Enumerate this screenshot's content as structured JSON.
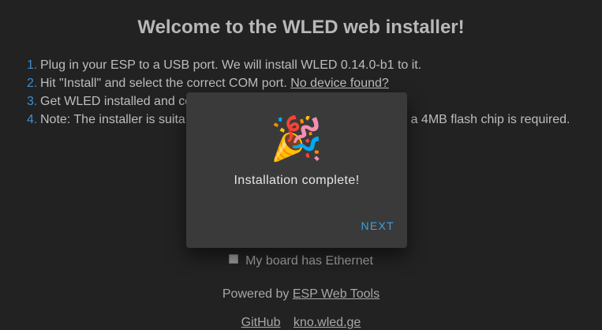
{
  "page": {
    "title": "Welcome to the WLED web installer!",
    "steps": [
      {
        "num": "1.",
        "text": "Plug in your ESP to a USB port. We will install WLED 0.14.0-b1 to it."
      },
      {
        "num": "2.",
        "text": "Hit \"Install\" and select the correct COM port. ",
        "link": "No device found?"
      },
      {
        "num": "3.",
        "text": "Get WLED installed and co"
      },
      {
        "num": "4.",
        "text": "Note: The installer is suita",
        "text_tail": "ds, a 4MB flash chip is required."
      }
    ],
    "ethernet_label": "My board has Ethernet",
    "powered_by_prefix": "Powered by ",
    "powered_by_link": "ESP Web Tools",
    "footer_links": [
      "GitHub",
      "kno.wled.ge"
    ]
  },
  "dialog": {
    "icon": "party-popper-icon",
    "emoji": "🎉",
    "message": "Installation complete!",
    "next_label": "NEXT"
  },
  "colors": {
    "background": "#222222",
    "dialog_background": "#3a3a3a",
    "accent": "#3aa3e3",
    "step_number": "#3d8fd1"
  }
}
